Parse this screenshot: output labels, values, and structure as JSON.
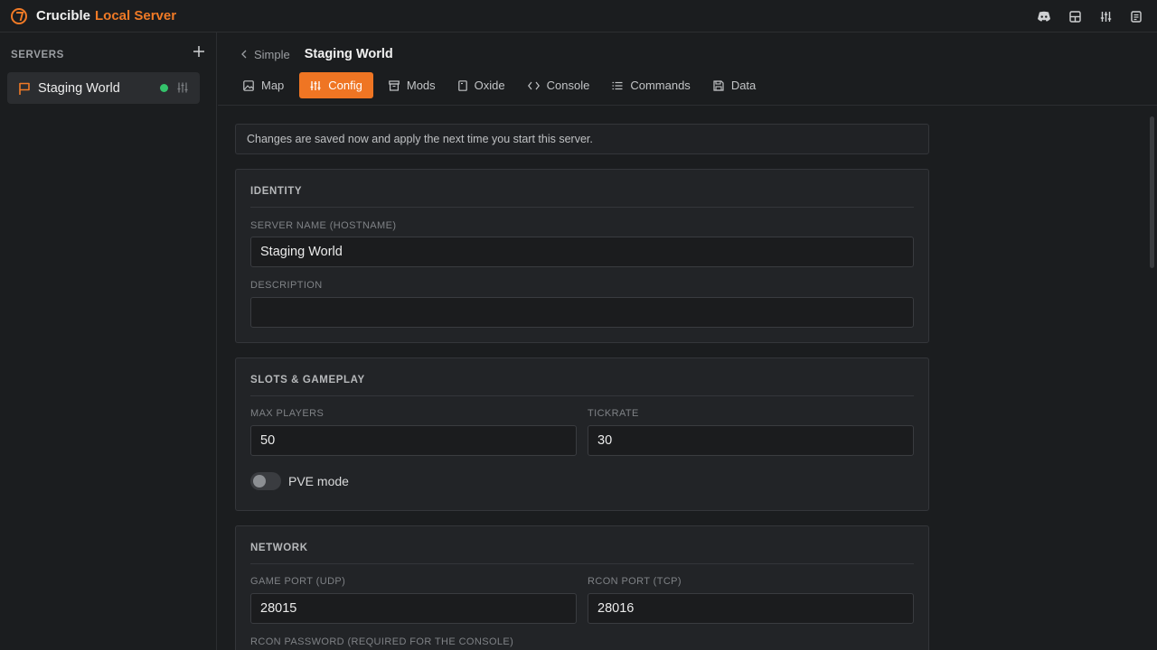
{
  "app": {
    "name": "Crucible",
    "name_accent": "Local Server",
    "accent_color": "#ef7523",
    "title_icons": [
      "discord-icon",
      "layout-icon",
      "sliders-icon",
      "notes-icon"
    ]
  },
  "sidebar": {
    "heading": "SERVERS",
    "add_icon": "plus-icon",
    "servers": [
      {
        "name": "Staging World",
        "status": "running",
        "status_color": "#34c36b"
      }
    ]
  },
  "breadcrumb": {
    "back_label": "Simple",
    "title": "Staging World"
  },
  "tabs": [
    {
      "label": "Map",
      "icon": "image-icon",
      "active": false
    },
    {
      "label": "Config",
      "icon": "sliders-icon",
      "active": true
    },
    {
      "label": "Mods",
      "icon": "archive-icon",
      "active": false
    },
    {
      "label": "Oxide",
      "icon": "file-icon",
      "active": false
    },
    {
      "label": "Console",
      "icon": "code-icon",
      "active": false
    },
    {
      "label": "Commands",
      "icon": "list-icon",
      "active": false
    },
    {
      "label": "Data",
      "icon": "save-icon",
      "active": false
    }
  ],
  "notice": "Changes are saved now and apply the next time you start this server.",
  "identity": {
    "title": "IDENTITY",
    "server_name_label": "SERVER NAME (HOSTNAME)",
    "server_name_value": "Staging World",
    "description_label": "DESCRIPTION",
    "description_value": ""
  },
  "gameplay": {
    "title": "SLOTS & GAMEPLAY",
    "max_players_label": "MAX PLAYERS",
    "max_players_value": "50",
    "tickrate_label": "TICKRATE",
    "tickrate_value": "30",
    "pve_label": "PVE mode",
    "pve_enabled": false
  },
  "network": {
    "title": "NETWORK",
    "game_port_label": "GAME PORT (UDP)",
    "game_port_value": "28015",
    "rcon_port_label": "RCON PORT (TCP)",
    "rcon_port_value": "28016",
    "rcon_password_label": "RCON PASSWORD (REQUIRED FOR THE CONSOLE)"
  }
}
